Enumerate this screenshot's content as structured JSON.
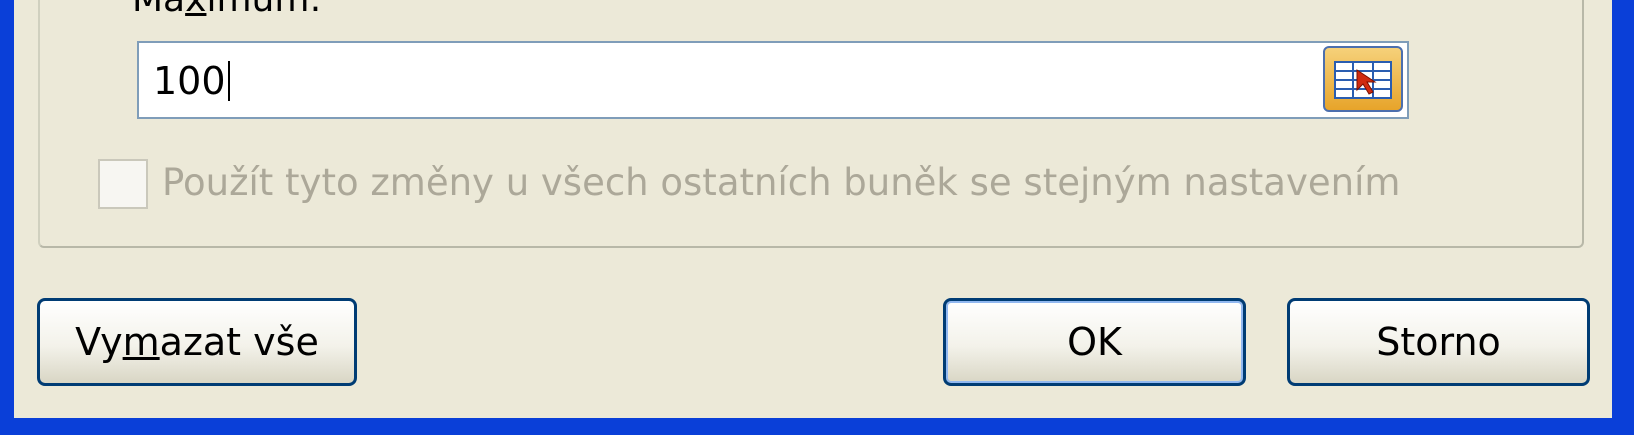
{
  "dialog": {
    "maximum_label_prefix": "Ma",
    "maximum_label_accel": "x",
    "maximum_label_suffix": "imum:",
    "maximum_value": "100",
    "apply_label": "Použít tyto změny u všech ostatních buněk se stejným nastavením",
    "apply_checked": false,
    "apply_enabled": false
  },
  "buttons": {
    "clear_prefix": "Vy",
    "clear_accel": "m",
    "clear_suffix": "azat vše",
    "ok": "OK",
    "cancel": "Storno"
  },
  "icons": {
    "range_picker": "cell-range-selector-icon"
  }
}
